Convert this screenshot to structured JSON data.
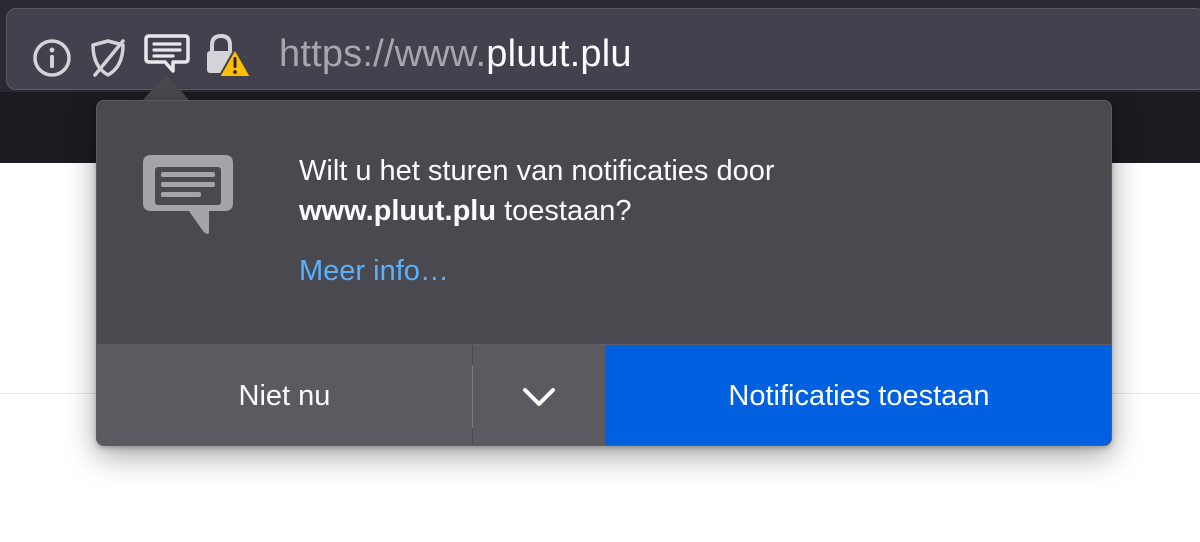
{
  "urlbar": {
    "scheme_prefix": "https://www.",
    "host": "pluut.plu",
    "icons": [
      "info-icon",
      "tracking-protection-off-icon",
      "notification-permission-icon",
      "insecure-lock-warning-icon"
    ]
  },
  "permission_prompt": {
    "message_line1": "Wilt u het sturen van notificaties door",
    "host_bold": "www.pluut.plu",
    "message_line2_rest": " toestaan?",
    "more_info_label": "Meer info…",
    "secondary_button_label": "Niet nu",
    "dropdown_icon": "chevron-down-icon",
    "primary_button_label": "Notificaties toestaan",
    "icon": "notification-icon"
  },
  "colors": {
    "toolbar": "#2b2a33",
    "urlbar": "#42414d",
    "panel": "#4a4950",
    "primary_button": "#0060df",
    "link": "#56b1ff",
    "warning": "#ffbf00"
  }
}
